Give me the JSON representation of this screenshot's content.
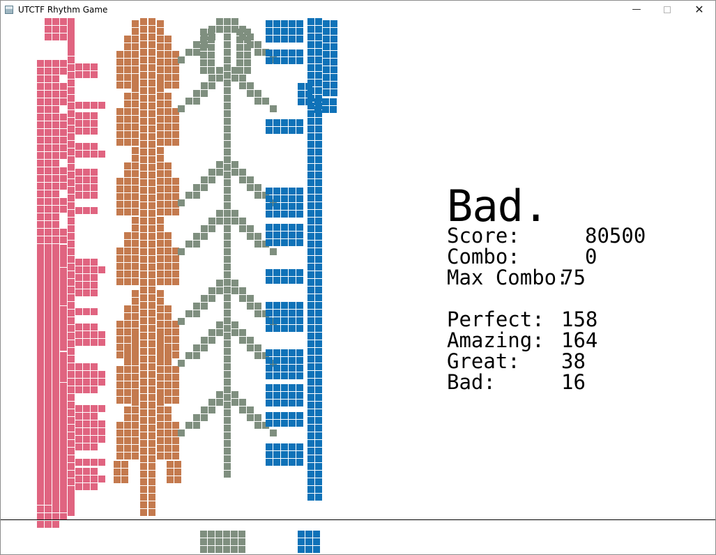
{
  "window": {
    "title": "UTCTF Rhythm Game",
    "controls": {
      "minimize": "—",
      "close": "✕"
    }
  },
  "colors": {
    "lane_1": "#e06480",
    "lane_2": "#c47a4e",
    "lane_3": "#7f8f7f",
    "lane_4": "#0f72b8",
    "judgement_line": "#000000",
    "text": "#000000"
  },
  "stats": {
    "judgement": "Bad.",
    "score_label": "Score:",
    "score": "80500",
    "combo_label": "Combo:",
    "combo": "0",
    "max_combo_label": "Max Combo:",
    "max_combo": "75",
    "perfect_label": "Perfect:",
    "perfect": "158",
    "amazing_label": "Amazing:",
    "amazing": "164",
    "great_label": "Great:",
    "great": "38",
    "bad_label": "Bad:",
    "bad": "16"
  }
}
